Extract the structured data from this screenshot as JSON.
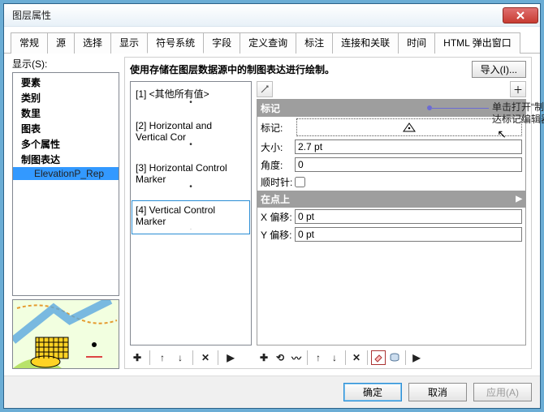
{
  "window": {
    "title": "图层属性"
  },
  "tabs": [
    "常规",
    "源",
    "选择",
    "显示",
    "符号系统",
    "字段",
    "定义查询",
    "标注",
    "连接和关联",
    "时间",
    "HTML 弹出窗口"
  ],
  "active_tab_index": 4,
  "show_label": "显示(S):",
  "tree": {
    "items": [
      "要素",
      "类别",
      "数里",
      "图表",
      "多个属性",
      "制图表达"
    ],
    "child": "ElevationP_Rep",
    "selected_index": 5
  },
  "mid": {
    "heading": "使用存储在图层数据源中的制图表达进行绘制。",
    "import_label": "导入(I)..."
  },
  "rules": [
    {
      "label": "[1] <其他所有值>"
    },
    {
      "label": "[2] Horizontal and Vertical Cor"
    },
    {
      "label": "[3] Horizontal Control Marker"
    },
    {
      "label": "[4] Vertical Control Marker"
    }
  ],
  "rules_selected_index": 3,
  "panel": {
    "section1": "标记",
    "marker_label": "标记:",
    "size_label": "大小:",
    "size_value": "2.7 pt",
    "angle_label": "角度:",
    "angle_value": "0",
    "clockwise_label": "顺时针:",
    "section2": "在点上",
    "xoff_label": "X 偏移:",
    "xoff_value": "0 pt",
    "yoff_label": "Y 偏移:",
    "yoff_value": "0 pt"
  },
  "callout_text": "单击打开“制图表达标记编辑器”",
  "footer": {
    "ok": "确定",
    "cancel": "取消",
    "apply": "应用(A)"
  }
}
